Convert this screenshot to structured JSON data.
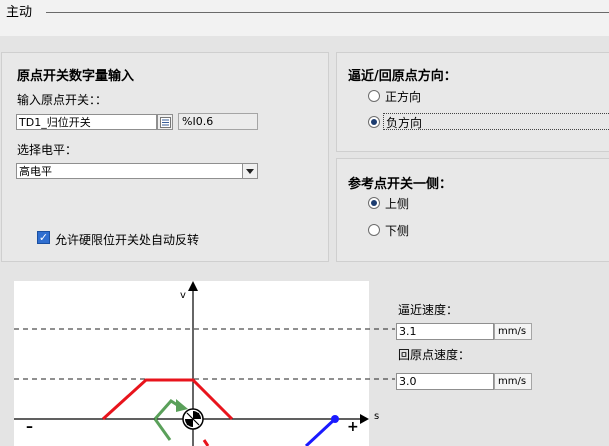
{
  "header": {
    "title": "主动"
  },
  "homing_input": {
    "heading": "原点开关数字量输入",
    "input_label": "输入原点开关：：",
    "input_value": "TD1_归位开关",
    "address": "%I0.6",
    "level_label": "选择电平：",
    "level_value": "高电平",
    "auto_reverse_label": "允许硬限位开关处自动反转",
    "auto_reverse_checked": true
  },
  "direction": {
    "heading": "逼近/回原点方向：",
    "options": [
      {
        "label": "正方向",
        "selected": false
      },
      {
        "label": "负方向",
        "selected": true
      }
    ]
  },
  "switch_side": {
    "heading": "参考点开关一侧：",
    "options": [
      {
        "label": "上侧",
        "selected": true
      },
      {
        "label": "下侧",
        "selected": false
      }
    ]
  },
  "diagram": {
    "axis_v": "v",
    "axis_s": "s",
    "minus": "–",
    "plus": "+"
  },
  "speeds": {
    "approach_label": "逼近速度：",
    "approach_value": "3.1",
    "approach_unit": "mm/s",
    "homing_label": "回原点速度：",
    "homing_value": "3.0",
    "homing_unit": "mm/s"
  },
  "colors": {
    "red": "#e8141c",
    "green": "#5aa05a",
    "blue": "#1a1aff",
    "radio_dot": "#1c3c70",
    "checkbox": "#2f6ed0"
  }
}
